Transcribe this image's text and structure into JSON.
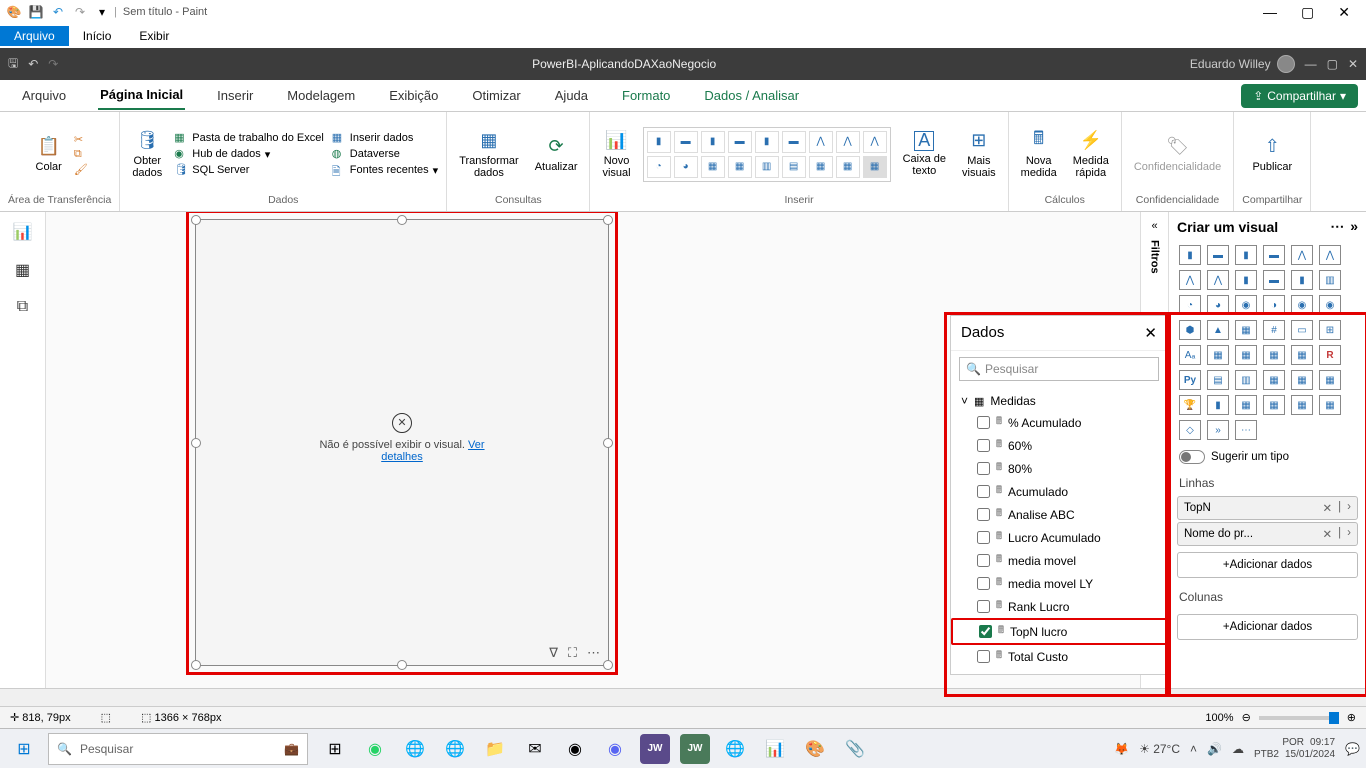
{
  "paint": {
    "title": "Sem título - Paint",
    "menu": {
      "arquivo": "Arquivo",
      "inicio": "Início",
      "exibir": "Exibir"
    },
    "status": {
      "pos": "818, 79px",
      "size": "1366 × 768px",
      "zoom": "100%"
    }
  },
  "pbi": {
    "title": "PowerBI-AplicandoDAXaoNegocio",
    "user": "Eduardo Willey",
    "tabs": {
      "arquivo": "Arquivo",
      "pagina": "Página Inicial",
      "inserir": "Inserir",
      "modelagem": "Modelagem",
      "exibicao": "Exibição",
      "otimizar": "Otimizar",
      "ajuda": "Ajuda",
      "formato": "Formato",
      "dados": "Dados / Analisar"
    },
    "share": "Compartilhar",
    "ribbon": {
      "clipboard": {
        "colar": "Colar",
        "label": "Área de Transferência"
      },
      "dados": {
        "obter": "Obter\ndados",
        "excel": "Pasta de trabalho do Excel",
        "hub": "Hub de dados",
        "sql": "SQL Server",
        "inserir": "Inserir dados",
        "dataverse": "Dataverse",
        "fontes": "Fontes recentes",
        "label": "Dados"
      },
      "consultas": {
        "transformar": "Transformar\ndados",
        "atualizar": "Atualizar",
        "label": "Consultas"
      },
      "inserir": {
        "novo": "Novo\nvisual",
        "caixa": "Caixa de\ntexto",
        "mais": "Mais\nvisuais",
        "label": "Inserir"
      },
      "calculos": {
        "nova": "Nova\nmedida",
        "rapida": "Medida\nrápida",
        "label": "Cálculos"
      },
      "conf": {
        "btn": "Confidencialidade",
        "label": "Confidencialidade"
      },
      "comp": {
        "btn": "Publicar",
        "label": "Compartilhar"
      }
    },
    "visual_error": {
      "msg": "Não é possível exibir o visual.",
      "link": "Ver detalhes"
    },
    "filters_label": "Filtros",
    "dados_panel": {
      "title": "Dados",
      "search": "Pesquisar",
      "table": "Medidas",
      "fields": [
        {
          "label": "% Acumulado",
          "checked": false
        },
        {
          "label": "60%",
          "checked": false
        },
        {
          "label": "80%",
          "checked": false
        },
        {
          "label": "Acumulado",
          "checked": false
        },
        {
          "label": "Analise ABC",
          "checked": false
        },
        {
          "label": "Lucro Acumulado",
          "checked": false
        },
        {
          "label": "media movel",
          "checked": false
        },
        {
          "label": "media movel LY",
          "checked": false
        },
        {
          "label": "Rank Lucro",
          "checked": false
        },
        {
          "label": "TopN lucro",
          "checked": true,
          "hl": true
        },
        {
          "label": "Total Custo",
          "checked": false
        }
      ]
    },
    "viz_panel": {
      "title": "Criar um visual",
      "suggest": "Sugerir um tipo",
      "linhas": "Linhas",
      "colunas": "Colunas",
      "field1": "TopN",
      "field2": "Nome do pr...",
      "add": "+Adicionar dados"
    }
  },
  "taskbar": {
    "search": "Pesquisar",
    "weather": "27°C",
    "lang1": "POR",
    "lang2": "PTB2",
    "time": "09:17",
    "date": "15/01/2024"
  }
}
